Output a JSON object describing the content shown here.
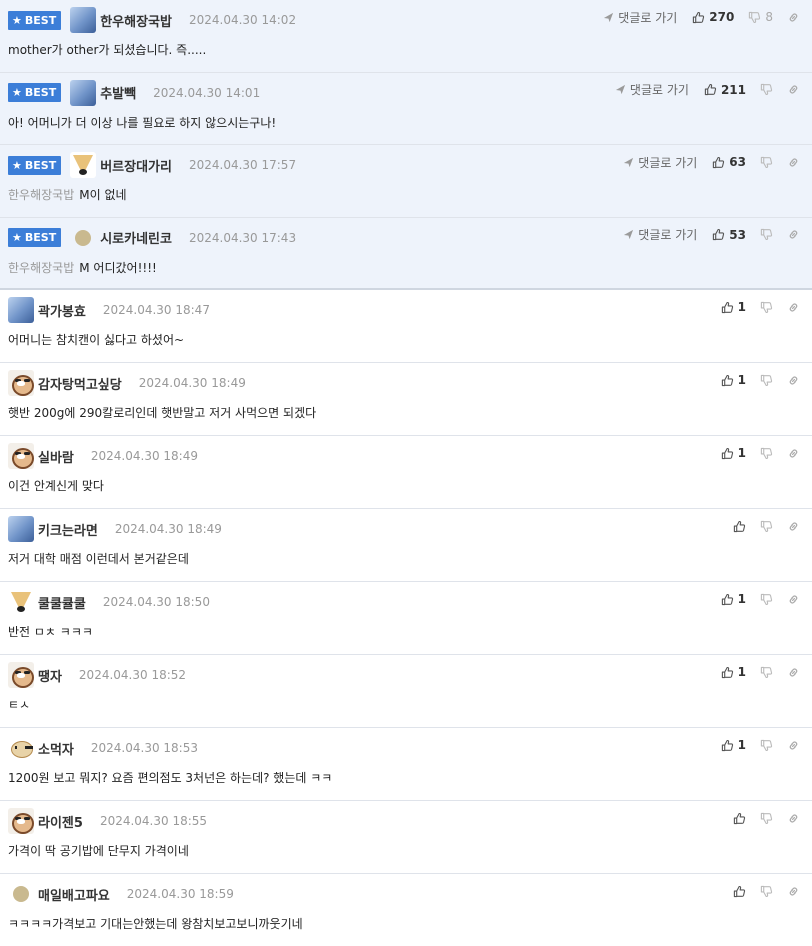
{
  "labels": {
    "best": "BEST",
    "goto_reply": "댓글로 가기"
  },
  "colors": {
    "best_bg": "#eef3fb",
    "badge": "#3c7ed8",
    "date": "#999999"
  },
  "best_comments": [
    {
      "avatar": "blue",
      "nick": "한우해장국밥",
      "date": "2024.04.30 14:02",
      "reply_to": "",
      "text": "mother가 other가 되셨습니다. 즉.....",
      "up": "270",
      "down": "8"
    },
    {
      "avatar": "blue",
      "nick": "추발빽",
      "date": "2024.04.30 14:01",
      "reply_to": "",
      "text": "아! 어머니가 더 이상 나를 필요로 하지 않으시는구나!",
      "up": "211",
      "down": ""
    },
    {
      "avatar": "fox",
      "nick": "버르장대가리",
      "date": "2024.04.30 17:57",
      "reply_to": "한우해장국밥",
      "text": "M이 없네",
      "up": "63",
      "down": ""
    },
    {
      "avatar": "circle",
      "nick": "시로카네린코",
      "date": "2024.04.30 17:43",
      "reply_to": "한우해장국밥",
      "text": "M 어디갔어!!!!",
      "up": "53",
      "down": ""
    }
  ],
  "comments": [
    {
      "avatar": "blue",
      "nick": "곽가봉효",
      "date": "2024.04.30 18:47",
      "text": "어머니는 참치캔이 싫다고 하셨어~",
      "up": "1"
    },
    {
      "avatar": "dog",
      "nick": "감자탕먹고싶당",
      "date": "2024.04.30 18:49",
      "text": "햇반 200g에 290칼로리인데 햇반말고 저거 사먹으면 되겠다",
      "up": "1"
    },
    {
      "avatar": "dog",
      "nick": "실바람",
      "date": "2024.04.30 18:49",
      "text": "이건 안계신게 맞다",
      "up": "1"
    },
    {
      "avatar": "blue",
      "nick": "키크는라면",
      "date": "2024.04.30 18:49",
      "text": "저거 대학 매점 이런데서 본거같은데",
      "up": ""
    },
    {
      "avatar": "fox",
      "nick": "쿨쿨큘쿨",
      "date": "2024.04.30 18:50",
      "text": "반전 ㅁㅊ ㅋㅋㅋ",
      "up": "1"
    },
    {
      "avatar": "dog",
      "nick": "땡자",
      "date": "2024.04.30 18:52",
      "text": "ㅌㅅ",
      "up": "1"
    },
    {
      "avatar": "pup",
      "nick": "소먹자",
      "date": "2024.04.30 18:53",
      "text": "1200원 보고 뭐지? 요즘 편의점도 3처넌은 하는데? 했는데 ㅋㅋ",
      "up": "1"
    },
    {
      "avatar": "dog",
      "nick": "라이젠5",
      "date": "2024.04.30 18:55",
      "text": "가격이 딱 공기밥에 단무지 가격이네",
      "up": ""
    },
    {
      "avatar": "circle",
      "nick": "매일배고파요",
      "date": "2024.04.30 18:59",
      "text": "ㅋㅋㅋㅋ가격보고 기대는안했는데 왕참치보고보니까웃기네",
      "up": ""
    }
  ]
}
